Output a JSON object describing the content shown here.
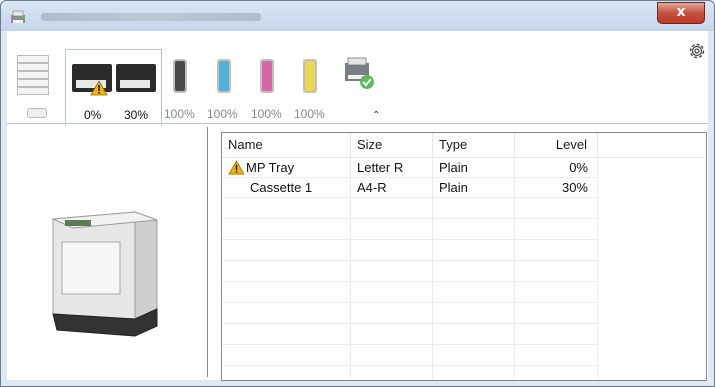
{
  "window": {
    "title": "",
    "close_label": "x"
  },
  "toolbar": {
    "tray_levels": [
      "0%",
      "30%"
    ],
    "toner_levels": [
      "100%",
      "100%",
      "100%",
      "100%"
    ],
    "collapse_glyph": "⌃",
    "toner_colors": [
      "#4a4a4a",
      "#4fb0d8",
      "#d865a8",
      "#e8d84a"
    ]
  },
  "table": {
    "columns": [
      "Name",
      "Size",
      "Type",
      "Level"
    ],
    "rows": [
      {
        "name": "MP Tray",
        "size": "Letter R",
        "type": "Plain",
        "level": "0%",
        "warning": true
      },
      {
        "name": "Cassette 1",
        "size": "A4-R",
        "type": "Plain",
        "level": "30%",
        "warning": false
      }
    ]
  },
  "colors": {
    "warning": "#f2b400",
    "accent": "#4aa3df"
  }
}
